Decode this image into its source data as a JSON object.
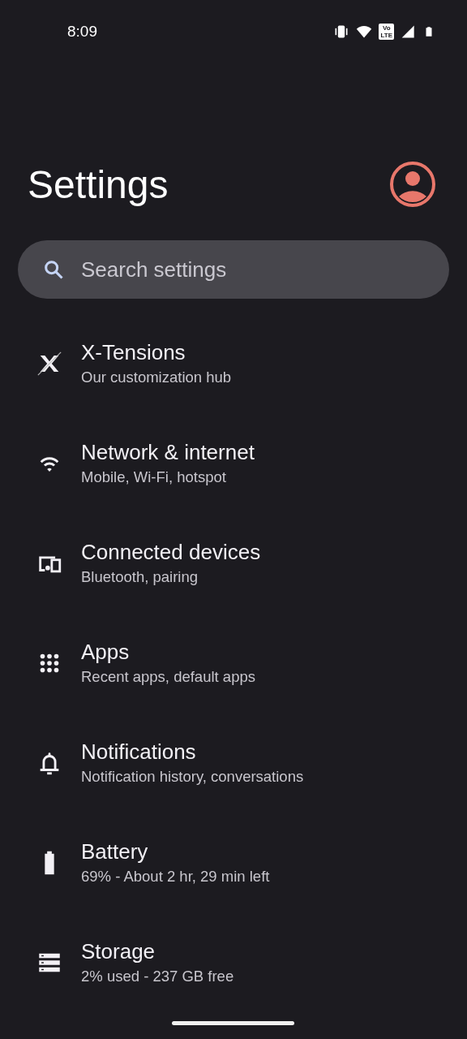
{
  "status_bar": {
    "time": "8:09",
    "volte": [
      "Vo",
      "LTE"
    ]
  },
  "header": {
    "title": "Settings"
  },
  "search": {
    "placeholder": "Search settings"
  },
  "items": [
    {
      "kind": "xtensions",
      "title": "X-Tensions",
      "subtitle": "Our customization hub"
    },
    {
      "kind": "wifi",
      "title": "Network & internet",
      "subtitle": "Mobile, Wi-Fi, hotspot"
    },
    {
      "kind": "devices",
      "title": "Connected devices",
      "subtitle": "Bluetooth, pairing"
    },
    {
      "kind": "apps",
      "title": "Apps",
      "subtitle": "Recent apps, default apps"
    },
    {
      "kind": "bell",
      "title": "Notifications",
      "subtitle": "Notification history, conversations"
    },
    {
      "kind": "battery",
      "title": "Battery",
      "subtitle": "69% - About 2 hr, 29 min left"
    },
    {
      "kind": "storage",
      "title": "Storage",
      "subtitle": "2% used - 237 GB free"
    }
  ]
}
